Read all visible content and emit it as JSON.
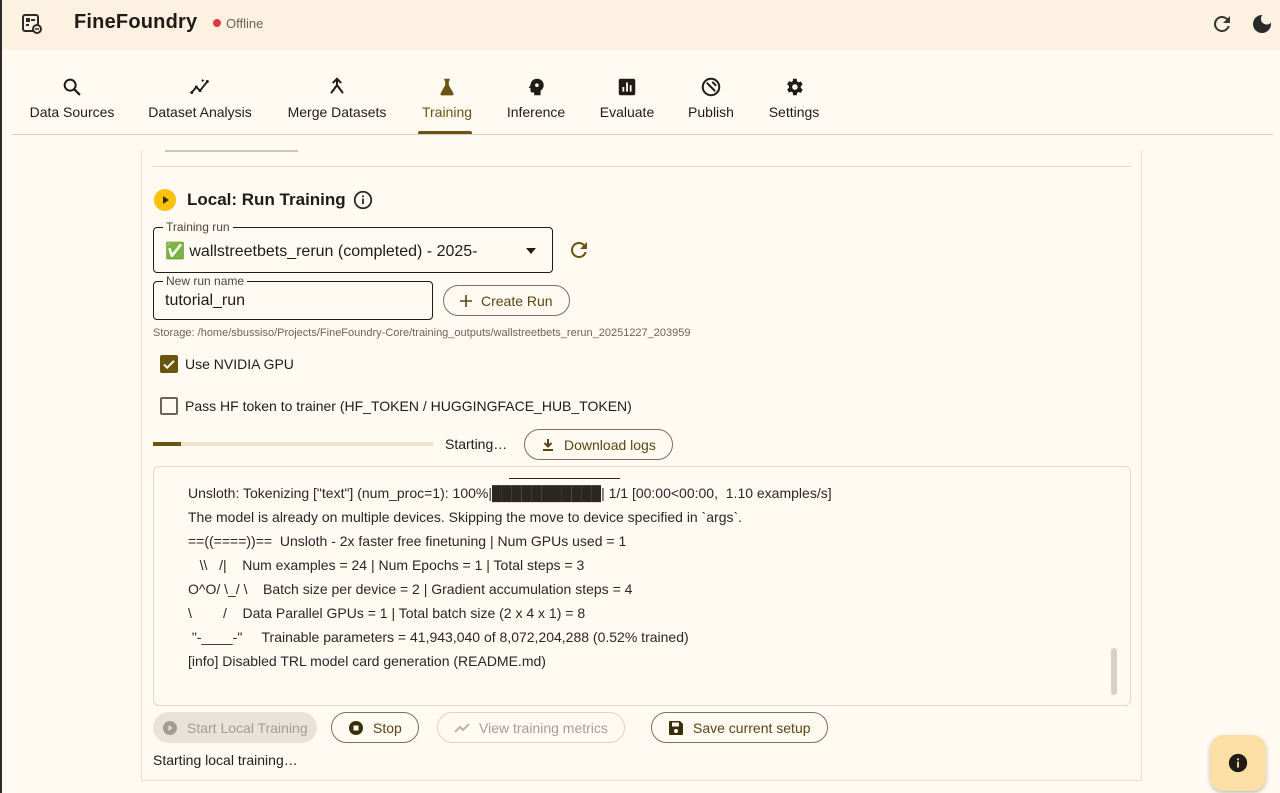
{
  "app": {
    "title": "FineFoundry",
    "status": "Offline",
    "status_color": "#e53935",
    "accent_color": "#6b5310"
  },
  "tabs": [
    {
      "label": "Data Sources",
      "icon": "search-icon"
    },
    {
      "label": "Dataset Analysis",
      "icon": "insights-icon"
    },
    {
      "label": "Merge Datasets",
      "icon": "merge-icon"
    },
    {
      "label": "Training",
      "icon": "flask-icon",
      "active": true
    },
    {
      "label": "Inference",
      "icon": "psychology-icon"
    },
    {
      "label": "Evaluate",
      "icon": "bar-chart-icon"
    },
    {
      "label": "Publish",
      "icon": "publish-icon"
    },
    {
      "label": "Settings",
      "icon": "gear-icon"
    }
  ],
  "section": {
    "title": "Local: Run Training"
  },
  "training_run": {
    "label": "Training run",
    "value": "✅ wallstreetbets_rerun (completed) - 2025-"
  },
  "new_run": {
    "label": "New run name",
    "value": "tutorial_run",
    "create_label": "Create Run"
  },
  "storage": "Storage: /home/sbussiso/Projects/FineFoundry-Core/training_outputs/wallstreetbets_rerun_20251227_203959",
  "options": {
    "gpu_label": "Use NVIDIA GPU",
    "gpu_checked": true,
    "hf_label": "Pass HF token to trainer (HF_TOKEN / HUGGINGFACE_HUB_TOKEN)",
    "hf_checked": false
  },
  "progress": {
    "fraction": 0.1,
    "status": "Starting…",
    "download_label": "Download logs"
  },
  "log": [
    "Unsloth: Tokenizing [\"text\"] (num_proc=1): 100%|███████████| 1/1 [00:00<00:00,  1.10 examples/s]",
    "The model is already on multiple devices. Skipping the move to device specified in `args`.",
    "==((====))==  Unsloth - 2x faster free finetuning | Num GPUs used = 1",
    "   \\\\   /|    Num examples = 24 | Num Epochs = 1 | Total steps = 3",
    "O^O/ \\_/ \\    Batch size per device = 2 | Gradient accumulation steps = 4",
    "\\        /    Data Parallel GPUs = 1 | Total batch size (2 x 4 x 1) = 8",
    " \"-____-\"     Trainable parameters = 41,943,040 of 8,072,204,288 (0.52% trained)",
    "[info] Disabled TRL model card generation (README.md)"
  ],
  "actions": {
    "start_label": "Start Local Training",
    "stop_label": "Stop",
    "metrics_label": "View training metrics",
    "save_label": "Save current setup"
  },
  "bottom_status": "Starting local training…"
}
